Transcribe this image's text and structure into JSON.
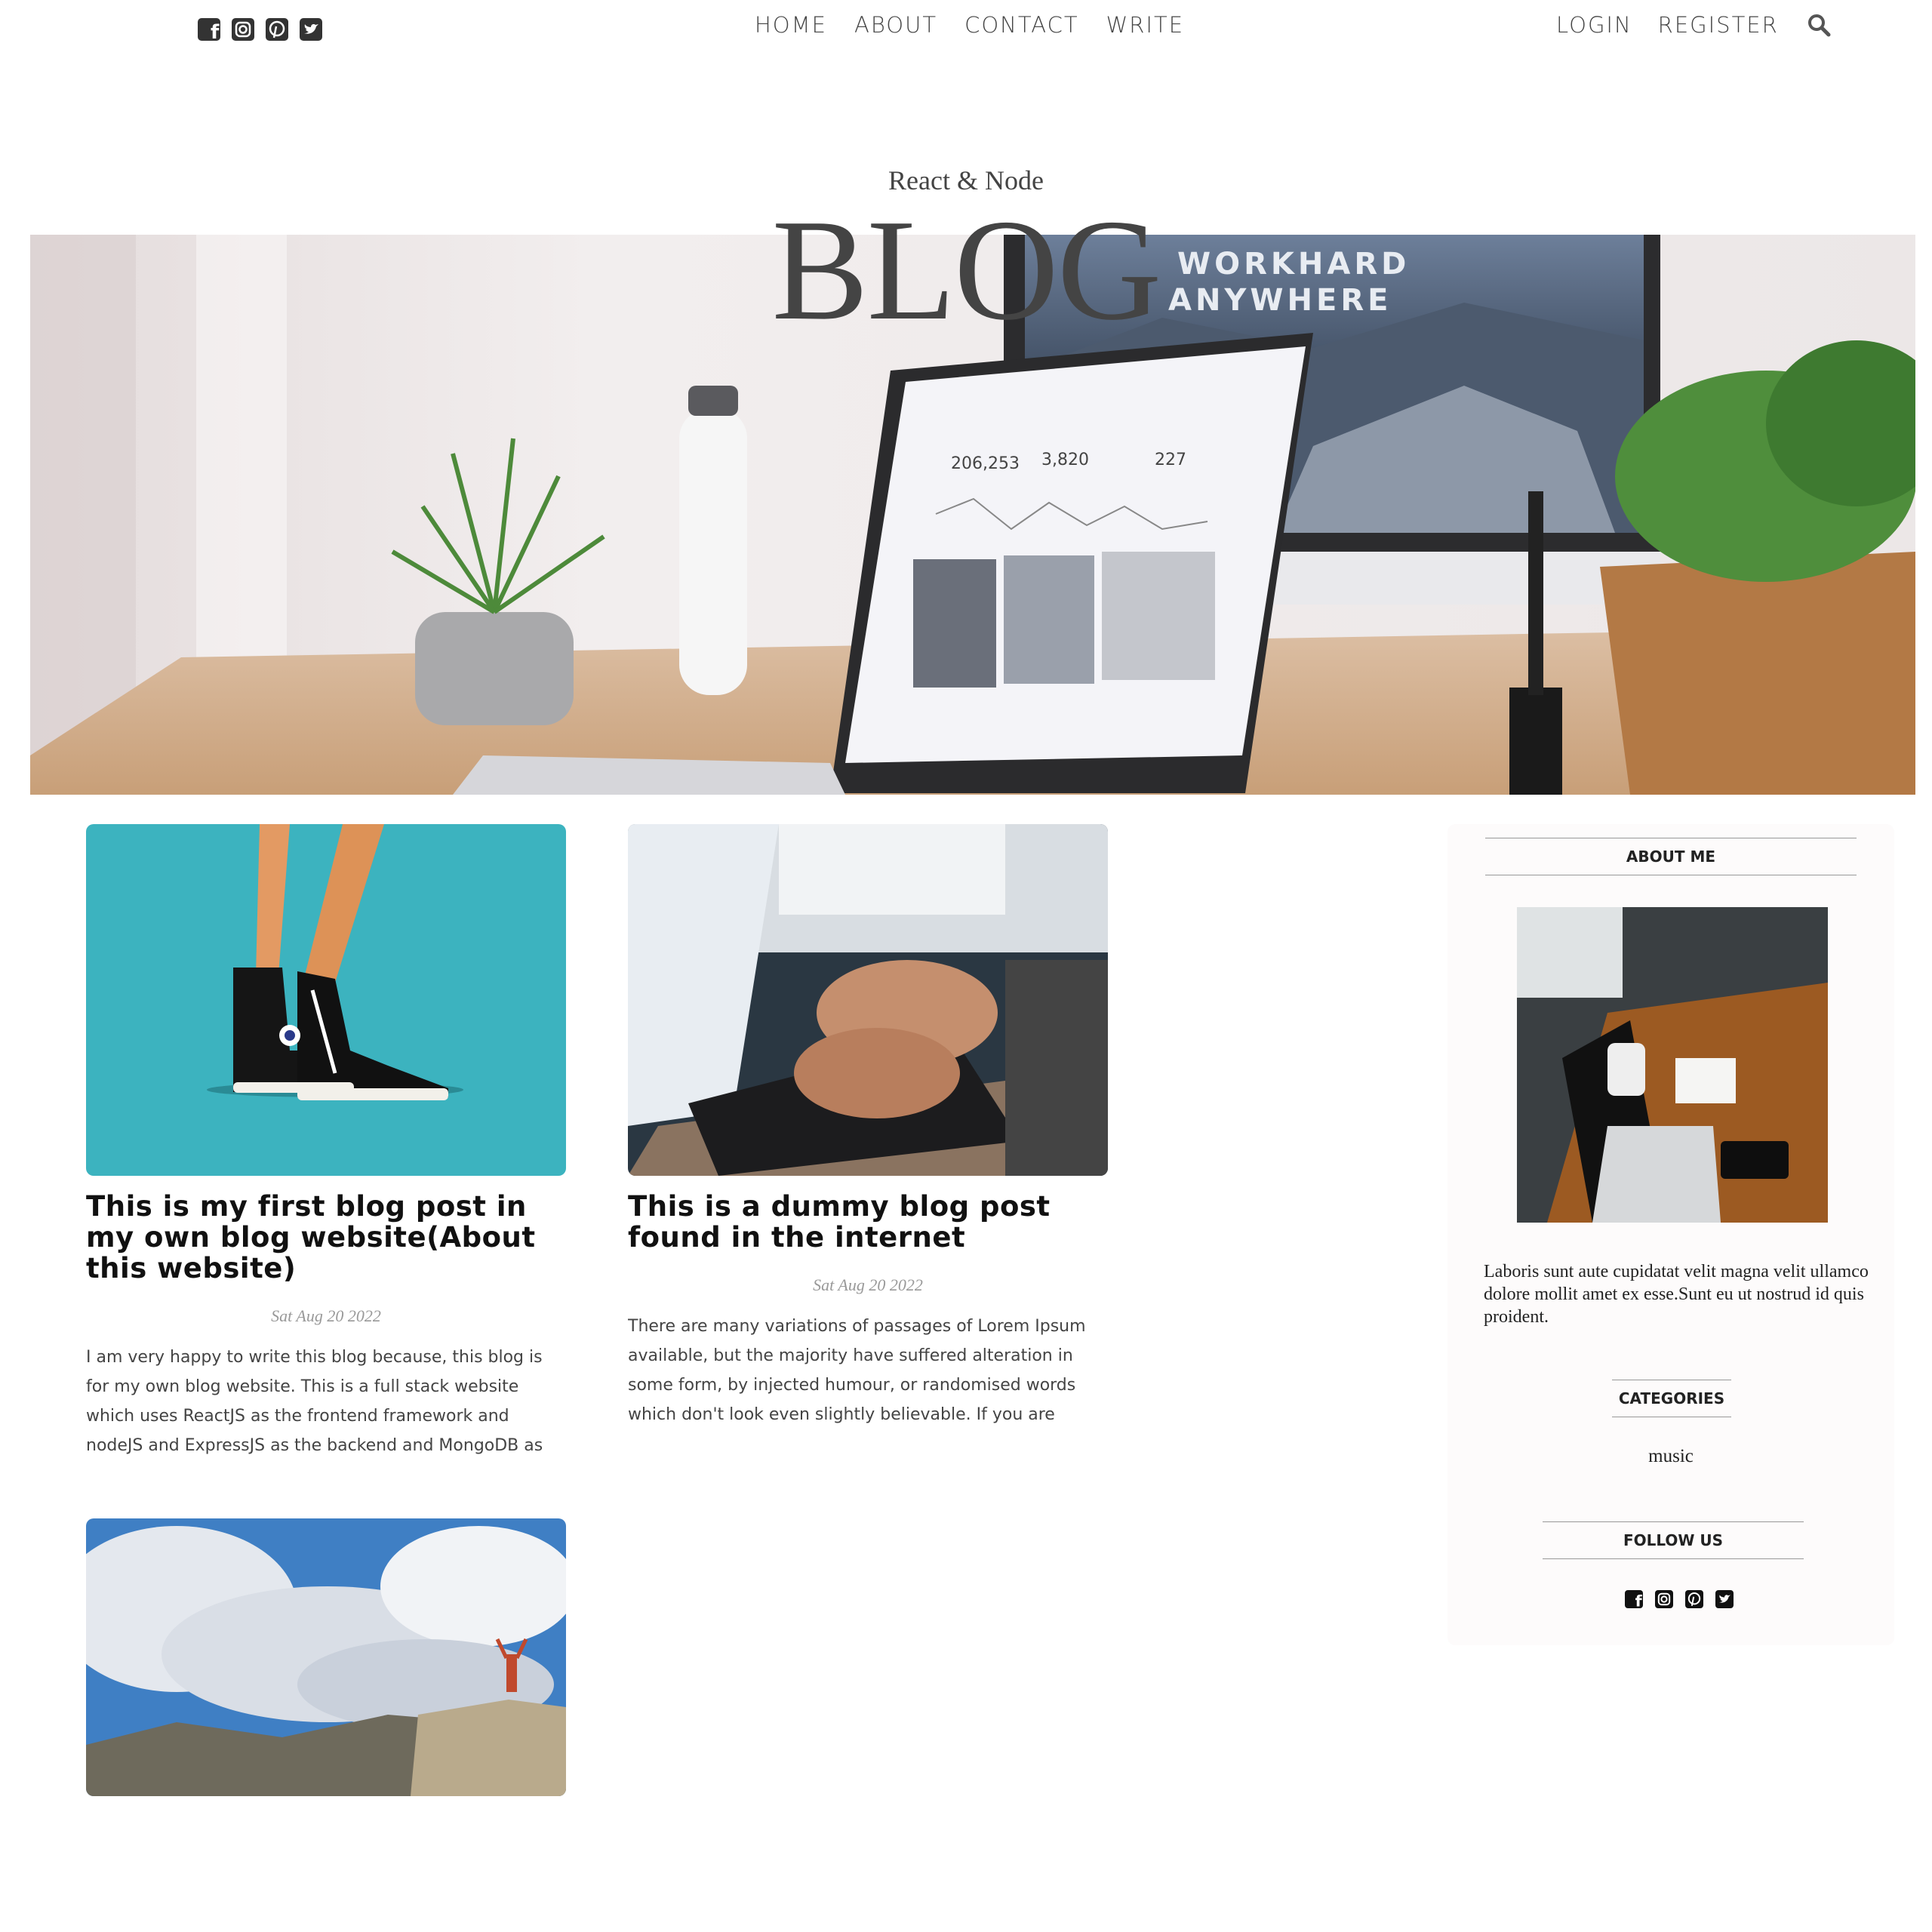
{
  "nav": {
    "social": [
      "facebook-icon",
      "instagram-icon",
      "pinterest-icon",
      "twitter-icon"
    ],
    "links": [
      "HOME",
      "ABOUT",
      "CONTACT",
      "WRITE"
    ],
    "auth": [
      "LOGIN",
      "REGISTER"
    ],
    "search_icon": "search-icon"
  },
  "header": {
    "subtitle": "React & Node",
    "title": "BLOG"
  },
  "hero": {
    "screen_text_1": "WORKHARD",
    "screen_text_2": "ANYWHERE",
    "stats": [
      "206,253",
      "3,820",
      "227"
    ]
  },
  "posts": [
    {
      "title": "This is my first blog post in my own blog website(About this website)",
      "date": "Sat Aug 20 2022",
      "desc": "I am very happy to write this blog because, this blog is for my own blog website. This is a full stack website which uses ReactJS as the frontend framework and nodeJS and ExpressJS as the backend and MongoDB as the databa…"
    },
    {
      "title": "This is a dummy blog post found in the internet",
      "date": "Sat Aug 20 2022",
      "desc": "There are many variations of passages of Lorem Ipsum available, but the majority have suffered alteration in some form, by injected humour, or randomised words which don't look even slightly believable. If you are goin…"
    }
  ],
  "sidebar": {
    "about_title": "ABOUT ME",
    "about_text": "Laboris sunt aute cupidatat velit magna velit ullamco dolore mollit amet ex esse.Sunt eu ut nostrud id quis proident.",
    "categories_title": "CATEGORIES",
    "categories": [
      "music"
    ],
    "follow_title": "FOLLOW US"
  },
  "colors": {
    "text_dark": "#444444",
    "card_teal": "#3cb3bf",
    "sidebar_bg": "#fdfbfb"
  }
}
